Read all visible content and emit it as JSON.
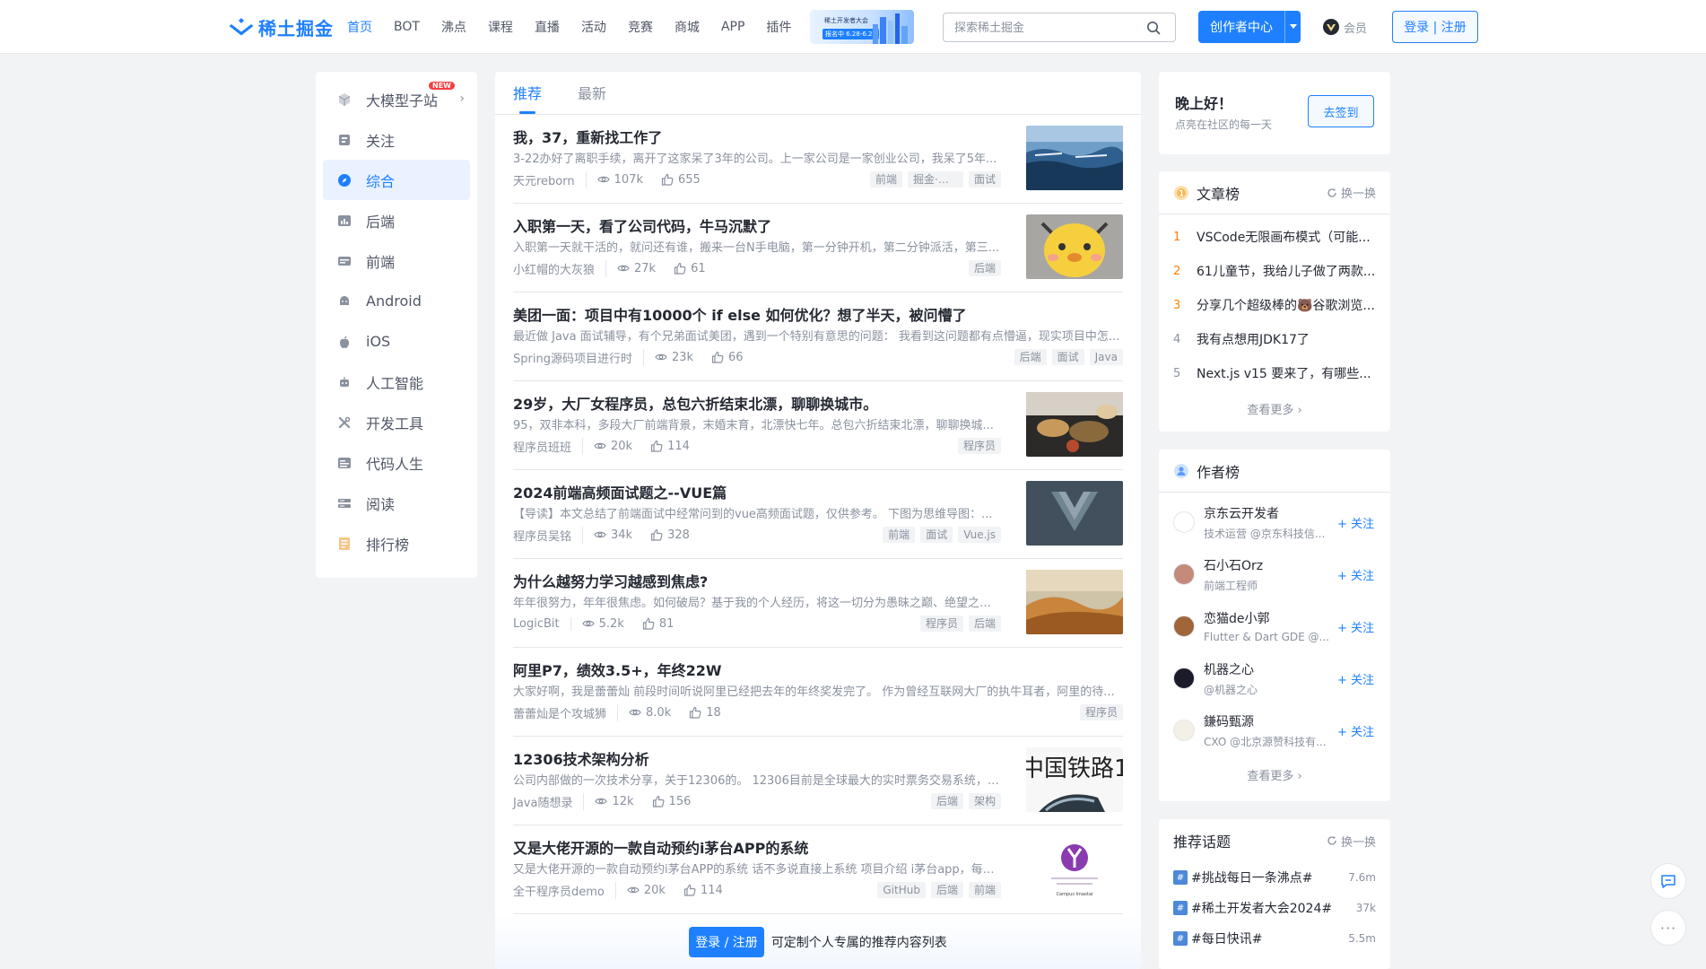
{
  "header": {
    "logo_text": "稀土掘金",
    "nav": [
      "首页",
      "BOT",
      "沸点",
      "课程",
      "直播",
      "活动",
      "竞赛",
      "商城",
      "APP",
      "插件"
    ],
    "nav_active": 0,
    "promo": {
      "line1": "稀土开发者大会",
      "line2": "报名中 6.28-6.29"
    },
    "search_placeholder": "探索稀土掘金",
    "creator_label": "创作者中心",
    "vip_label": "会员",
    "login_label": "登录 | 注册",
    "accent": "#1e80ff"
  },
  "sidebar": {
    "items": [
      {
        "label": "大模型子站",
        "icon": "cube-icon",
        "badge": "NEW",
        "chevron": true
      },
      {
        "label": "关注",
        "icon": "follow-icon"
      },
      {
        "label": "综合",
        "icon": "compass-icon",
        "active": true
      },
      {
        "label": "后端",
        "icon": "backend-icon"
      },
      {
        "label": "前端",
        "icon": "frontend-icon"
      },
      {
        "label": "Android",
        "icon": "android-icon"
      },
      {
        "label": "iOS",
        "icon": "apple-icon"
      },
      {
        "label": "人工智能",
        "icon": "robot-icon"
      },
      {
        "label": "开发工具",
        "icon": "tools-icon"
      },
      {
        "label": "代码人生",
        "icon": "code-life-icon"
      },
      {
        "label": "阅读",
        "icon": "book-icon"
      },
      {
        "label": "排行榜",
        "icon": "ranking-icon"
      }
    ]
  },
  "feed": {
    "tabs": [
      "推荐",
      "最新"
    ],
    "articles": [
      {
        "title": "我，37，重新找工作了",
        "abstract": "3-22办好了离职手续，离开了这家呆了3年的公司。上一家公司是一家创业公司，我呆了5年...",
        "author": "天元reborn",
        "views": "107k",
        "likes": "655",
        "tags": [
          "前端",
          "掘金·金...",
          "面试"
        ],
        "thumb": "ocean"
      },
      {
        "title": "入职第一天，看了公司代码，牛马沉默了",
        "abstract": "入职第一天就干活的，就问还有谁，搬来一台N手电脑，第一分钟开机，第二分钟派活，第三...",
        "author": "小红帽的大灰狼",
        "views": "27k",
        "likes": "61",
        "tags": [
          "后端"
        ],
        "thumb": "chick"
      },
      {
        "title": "美团一面：项目中有10000个 if else 如何优化？想了半天，被问懵了",
        "abstract": "最近做 Java 面试辅导，有个兄弟面试美团，遇到一个特别有意思的问题： 我看到这问题都有点懵逼，现实项目中怎...",
        "author": "Spring源码项目进行时",
        "views": "23k",
        "likes": "66",
        "tags": [
          "后端",
          "面试",
          "Java"
        ],
        "thumb": ""
      },
      {
        "title": "29岁，大厂女程序员，总包六折结束北漂，聊聊换城市。",
        "abstract": "95，双非本科，多段大厂前端背景，末婚末育，北漂快七年。总包六折结束北漂，聊聊换城...",
        "author": "程序员班班",
        "views": "20k",
        "likes": "114",
        "tags": [
          "程序员"
        ],
        "thumb": "food"
      },
      {
        "title": "2024前端高频面试题之--VUE篇",
        "abstract": "【导读】本文总结了前端面试中经常问到的vue高频面试题，仅供参考。 下图为思维导图：...",
        "author": "程序员吴铭",
        "views": "34k",
        "likes": "328",
        "tags": [
          "前端",
          "面试",
          "Vue.js"
        ],
        "thumb": "vue",
        "thumb_text": "Vue.js"
      },
      {
        "title": "为什么越努力学习越感到焦虑?",
        "abstract": "年年很努力，年年很焦虑。如何破局？基于我的个人经历，将这一切分为愚昧之巅、绝望之谷...",
        "author": "LogicBit",
        "views": "5.2k",
        "likes": "81",
        "tags": [
          "程序员",
          "后端"
        ],
        "thumb": "desert"
      },
      {
        "title": "阿里P7，绩效3.5+，年终22W",
        "abstract": "大家好啊，我是蕾蕾灿 前段时间听说阿里已经把去年的年终奖发完了。 作为曾经互联网大厂的执牛耳者，阿里的待...",
        "author": "蕾蕾灿是个攻城狮",
        "views": "8.0k",
        "likes": "18",
        "tags": [
          "程序员"
        ],
        "thumb": ""
      },
      {
        "title": "12306技术架构分析",
        "abstract": "公司内部做的一次技术分享，关于12306的。 12306目前是全球最大的实时票务交易系统，最...",
        "author": "Java随想录",
        "views": "12k",
        "likes": "156",
        "tags": [
          "后端",
          "架构"
        ],
        "thumb": "rail",
        "thumb_text": "中国铁路1"
      },
      {
        "title": "又是大佬开源的一款自动预约i茅台APP的系统",
        "abstract": "又是大佬开源的一款自动预约i茅台APP的系统 话不多说直接上系统 项目介绍 i茅台app，每日...",
        "author": "全干程序员demo",
        "views": "20k",
        "likes": "114",
        "tags": [
          "GitHub",
          "后端",
          "前端"
        ],
        "thumb": "logo",
        "thumb_text": "Campus Imaotai"
      }
    ],
    "login_cta": {
      "button": "登录 / 注册",
      "text": "可定制个人专属的推荐内容列表"
    }
  },
  "greeting": {
    "title": "晚上好！",
    "subtitle": "点亮在社区的每一天",
    "button": "去签到"
  },
  "article_rank": {
    "title": "文章榜",
    "refresh": "换一换",
    "items": [
      "VSCode无限画布模式（可能...",
      "61儿童节，我给儿子做了两款...",
      "分享几个超级棒的🐻谷歌浏览...",
      "我有点想用JDK17了",
      "Next.js v15 要来了，有哪些..."
    ],
    "more": "查看更多 ›"
  },
  "author_rank": {
    "title": "作者榜",
    "follow": "+ 关注",
    "items": [
      {
        "name": "京东云开发者",
        "desc": "技术运营 @京东科技信...",
        "avatar_color": "#ffffff"
      },
      {
        "name": "石小石Orz",
        "desc": "前端工程师",
        "avatar_color": "#c48a7a"
      },
      {
        "name": "恋猫de小郭",
        "desc": "Flutter & Dart GDE @...",
        "avatar_color": "#a0663a"
      },
      {
        "name": "机器之心",
        "desc": "@机器之心",
        "avatar_color": "#1b1b2a"
      },
      {
        "name": "鎌码甄源",
        "desc": "CXO @北京源赞科技有...",
        "avatar_color": "#f5f0e6"
      }
    ],
    "more": "查看更多 ›"
  },
  "topics": {
    "title": "推荐话题",
    "refresh": "换一换",
    "items": [
      {
        "name": "#挑战每日一条沸点#",
        "count": "7.6m"
      },
      {
        "name": "#稀土开发者大会2024#",
        "count": "37k"
      },
      {
        "name": "#每日快讯#",
        "count": "5.5m"
      }
    ]
  }
}
